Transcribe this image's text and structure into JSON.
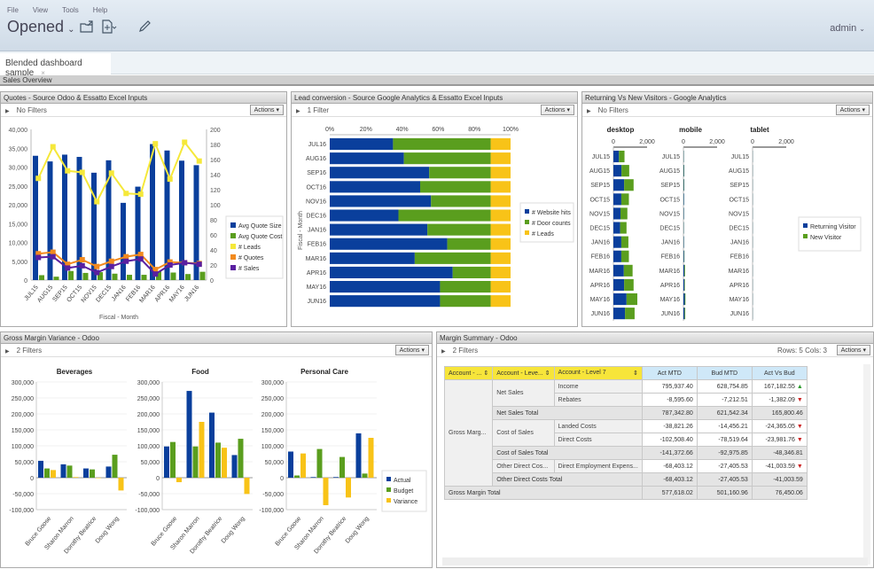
{
  "menu": [
    "File",
    "View",
    "Tools",
    "Help"
  ],
  "toolbar": {
    "title": "Opened",
    "user": "admin"
  },
  "tab": {
    "label": "Blended dashboard sample",
    "close": "×"
  },
  "section": "Sales Overview",
  "panels": {
    "quotes": {
      "title": "Quotes - Source Odoo & Essatto Excel Inputs",
      "filter": "No Filters",
      "actions": "Actions"
    },
    "leads": {
      "title": "Lead conversion - Source Google Analytics & Essatto Excel Inputs",
      "filter": "1 Filter",
      "actions": "Actions"
    },
    "visitors": {
      "title": "Returning Vs New Visitors - Google Analytics",
      "filter": "No Filters",
      "actions": "Actions"
    },
    "gm": {
      "title": "Gross Margin Variance - Odoo",
      "filter": "2 Filters",
      "actions": "Actions"
    },
    "summary": {
      "title": "Margin Summary - Odoo",
      "filter": "2 Filters",
      "actions": "Actions",
      "rowscols": "Rows: 5  Cols: 3"
    }
  },
  "chart_data": [
    {
      "id": "quotes",
      "type": "bar",
      "title": "",
      "xlabel": "Fiscal - Month",
      "categories": [
        "JUL15",
        "AUG15",
        "SEP15",
        "OCT15",
        "NOV15",
        "DEC15",
        "JAN16",
        "FEB16",
        "MAR16",
        "APR16",
        "MAY16",
        "JUN16"
      ],
      "y_left": {
        "ticks": [
          "0",
          "5,000",
          "10,000",
          "15,000",
          "20,000",
          "25,000",
          "30,000",
          "35,000",
          "40,000"
        ],
        "range": [
          0,
          40000
        ]
      },
      "y_right": {
        "ticks": [
          "0",
          "20",
          "40",
          "60",
          "80",
          "100",
          "120",
          "140",
          "160",
          "180",
          "200"
        ],
        "range": [
          0,
          200
        ]
      },
      "series": [
        {
          "name": "Avg Quote Size",
          "type": "bar",
          "axis": "left",
          "color": "#0a3f9c",
          "values": [
            33000,
            31500,
            33300,
            32700,
            28500,
            31800,
            20500,
            24800,
            36100,
            34400,
            31700,
            30500
          ]
        },
        {
          "name": "Avg Quote Cost",
          "type": "bar",
          "axis": "left",
          "color": "#5a9e1e",
          "values": [
            1300,
            900,
            2400,
            1900,
            2100,
            1700,
            1400,
            1400,
            2300,
            2000,
            1600,
            2200
          ]
        },
        {
          "name": "# Leads",
          "type": "line",
          "axis": "right",
          "color": "#f5e83a",
          "values": [
            135,
            177,
            145,
            143,
            104,
            142,
            115,
            114,
            181,
            134,
            183,
            158
          ]
        },
        {
          "name": "# Quotes",
          "type": "line",
          "axis": "right",
          "color": "#f28a1e",
          "values": [
            35,
            37,
            21,
            27,
            18,
            25,
            31,
            34,
            14,
            24,
            23,
            22
          ]
        },
        {
          "name": "# Sales",
          "type": "line",
          "axis": "right",
          "color": "#5a1fa0",
          "values": [
            30,
            31,
            16,
            19,
            10,
            18,
            25,
            28,
            8,
            20,
            23,
            21
          ]
        }
      ],
      "legend": "right"
    },
    {
      "id": "leads",
      "type": "bar",
      "orientation": "horizontal-stacked-100",
      "ylabel": "Fiscal - Month",
      "x_ticks": [
        "0%",
        "20%",
        "40%",
        "60%",
        "80%",
        "100%"
      ],
      "categories": [
        "JUL16",
        "AUG16",
        "SEP16",
        "OCT16",
        "NOV16",
        "DEC16",
        "JAN16",
        "FEB16",
        "MAR16",
        "APR16",
        "MAY16",
        "JUN16"
      ],
      "series": [
        {
          "name": "# Website hits",
          "color": "#0a3f9c",
          "values": [
            35,
            41,
            55,
            50,
            56,
            38,
            54,
            65,
            47,
            68,
            61,
            61
          ]
        },
        {
          "name": "# Door counts",
          "color": "#5a9e1e",
          "values": [
            54,
            48,
            34,
            39,
            33,
            51,
            35,
            24,
            42,
            21,
            28,
            28
          ]
        },
        {
          "name": "# Leads",
          "color": "#f8c318",
          "values": [
            11,
            11,
            11,
            11,
            11,
            11,
            11,
            11,
            11,
            11,
            11,
            11
          ]
        }
      ],
      "legend": "right"
    },
    {
      "id": "visitors",
      "type": "bar",
      "orientation": "horizontal-stacked",
      "panels": [
        "desktop",
        "mobile",
        "tablet"
      ],
      "x_ticks": [
        "0",
        "2,000"
      ],
      "categories": [
        "JUL15",
        "AUG15",
        "SEP15",
        "OCT15",
        "NOV15",
        "DEC15",
        "JAN16",
        "FEB16",
        "MAR16",
        "APR16",
        "MAY16",
        "JUN16"
      ],
      "series": [
        {
          "name": "Returning Visitor",
          "color": "#0a3f9c",
          "desktop": [
            330,
            480,
            640,
            470,
            420,
            400,
            470,
            470,
            620,
            640,
            780,
            690
          ],
          "mobile": [
            20,
            30,
            30,
            30,
            25,
            20,
            25,
            40,
            60,
            60,
            80,
            70
          ],
          "tablet": [
            10,
            10,
            10,
            10,
            10,
            10,
            10,
            10,
            10,
            10,
            10,
            10
          ]
        },
        {
          "name": "New Visitor",
          "color": "#5a9e1e",
          "desktop": [
            330,
            460,
            560,
            450,
            410,
            380,
            420,
            450,
            520,
            560,
            640,
            570
          ],
          "mobile": [
            10,
            20,
            20,
            10,
            10,
            10,
            10,
            20,
            40,
            30,
            40,
            40
          ],
          "tablet": [
            5,
            5,
            5,
            5,
            5,
            5,
            5,
            5,
            5,
            5,
            5,
            5
          ]
        }
      ],
      "legend": "right"
    },
    {
      "id": "gm",
      "type": "bar",
      "panels": [
        "Beverages",
        "Food",
        "Personal Care"
      ],
      "y_ticks": [
        "-100,000",
        "-50,000",
        "0",
        "50,000",
        "100,000",
        "150,000",
        "200,000",
        "250,000",
        "300,000"
      ],
      "range": [
        -100000,
        300000
      ],
      "categories": [
        "Bruce Goose",
        "Sharon Marron",
        "Dorothy Beatrice",
        "Doug Wong"
      ],
      "series": [
        {
          "name": "Actual",
          "color": "#0a3f9c",
          "Beverages": [
            53000,
            42000,
            29000,
            35000
          ],
          "Food": [
            98000,
            272000,
            204000,
            71000
          ],
          "Personal Care": [
            82000,
            2000,
            2000,
            139000
          ]
        },
        {
          "name": "Budget",
          "color": "#5a9e1e",
          "Beverages": [
            29000,
            38000,
            26000,
            72000
          ],
          "Food": [
            112000,
            98000,
            110000,
            122000
          ],
          "Personal Care": [
            7000,
            90000,
            65000,
            13000
          ]
        },
        {
          "name": "Variance",
          "color": "#f8c318",
          "Beverages": [
            24000,
            2000,
            0,
            -40000
          ],
          "Food": [
            -14000,
            175000,
            94000,
            -51000
          ],
          "Personal Care": [
            76000,
            -86000,
            -62000,
            125000
          ]
        }
      ],
      "legend": "right"
    }
  ],
  "summary": {
    "headers": [
      "Account - ...",
      "Account - Leve...",
      "Account - Level 7",
      "Act MTD",
      "Bud MTD",
      "Act Vs Bud"
    ],
    "group": "Gross Marg...",
    "rows": [
      {
        "l2": "Net Sales",
        "l3": "Income",
        "act": "795,937.40",
        "bud": "628,754.85",
        "var": "167,182.55",
        "trend": "up"
      },
      {
        "l2": "",
        "l3": "Rebates",
        "act": "-8,595.60",
        "bud": "-7,212.51",
        "var": "-1,382.09",
        "trend": "down"
      },
      {
        "total": "Net Sales Total",
        "act": "787,342.80",
        "bud": "621,542.34",
        "var": "165,800.46"
      },
      {
        "l2": "Cost of Sales",
        "l3": "Landed Costs",
        "act": "-38,821.26",
        "bud": "-14,456.21",
        "var": "-24,365.05",
        "trend": "down"
      },
      {
        "l2": "",
        "l3": "Direct Costs",
        "act": "-102,508.40",
        "bud": "-78,519.64",
        "var": "-23,981.76",
        "trend": "down"
      },
      {
        "total": "Cost of Sales Total",
        "act": "-141,372.66",
        "bud": "-92,975.85",
        "var": "-48,346.81"
      },
      {
        "l2": "Other Direct Cos...",
        "l3": "Direct Employment Expens...",
        "act": "-68,403.12",
        "bud": "-27,405.53",
        "var": "-41,003.59",
        "trend": "down"
      },
      {
        "total": "Other Direct Costs Total",
        "act": "-68,403.12",
        "bud": "-27,405.53",
        "var": "-41,003.59"
      }
    ],
    "grand": {
      "label": "Gross Margin Total",
      "act": "577,618.02",
      "bud": "501,160.96",
      "var": "76,450.06"
    }
  }
}
